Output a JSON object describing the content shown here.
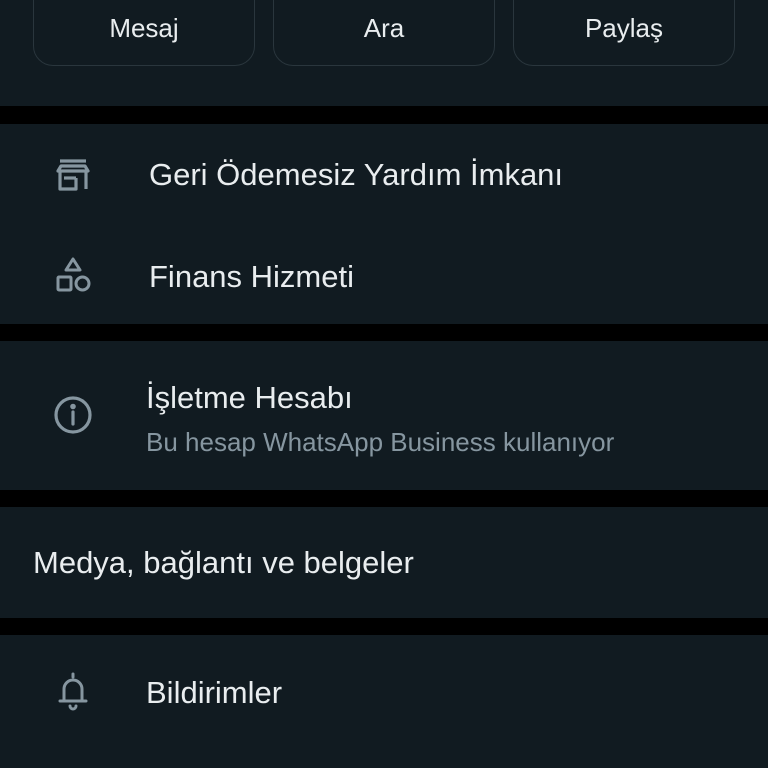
{
  "actions": {
    "message_label": "Mesaj",
    "call_label": "Ara",
    "share_label": "Paylaş"
  },
  "business_section": {
    "items": [
      {
        "icon": "storefront-icon",
        "label": "Geri Ödemesiz Yardım İmkanı"
      },
      {
        "icon": "shapes-category-icon",
        "label": "Finans Hizmeti"
      }
    ]
  },
  "account_section": {
    "icon": "info-icon",
    "title": "İşletme Hesabı",
    "subtitle": "Bu hesap WhatsApp Business kullanıyor"
  },
  "media_section": {
    "label": "Medya, bağlantı ve belgeler"
  },
  "notifications_section": {
    "icon": "bell-icon",
    "label": "Bildirimler"
  },
  "colors": {
    "background": "#000000",
    "surface": "#111b21",
    "primary_text": "#e9edef",
    "secondary_text": "#8696a0",
    "icon": "#8696a0",
    "button_border": "#2a363d"
  }
}
